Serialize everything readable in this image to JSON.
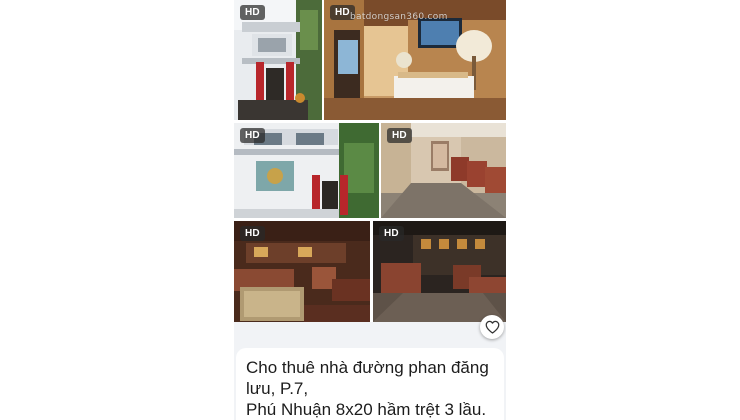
{
  "listing": {
    "photos": [
      {
        "name": "photo-house-exterior",
        "badge": "HD"
      },
      {
        "name": "photo-reception-hall",
        "badge": "HD",
        "watermark": "batdongsan360.com"
      },
      {
        "name": "photo-house-facade",
        "badge": "HD"
      },
      {
        "name": "photo-corridor-seating",
        "badge": "HD"
      },
      {
        "name": "photo-lounge-room",
        "badge": "HD"
      },
      {
        "name": "photo-basement-lounge",
        "badge": "HD"
      }
    ],
    "favorite_icon": "heart-outline-icon",
    "description": {
      "line1": "Cho thuê nhà đường  phan đăng",
      "line2": "lưu, P.7,",
      "line3": "Phú Nhuận 8x20 hầm trệt 3 lầu."
    }
  },
  "colors": {
    "card_background": "#f1f3f6",
    "badge_background": "#282828",
    "text": "#1c1c1c"
  }
}
